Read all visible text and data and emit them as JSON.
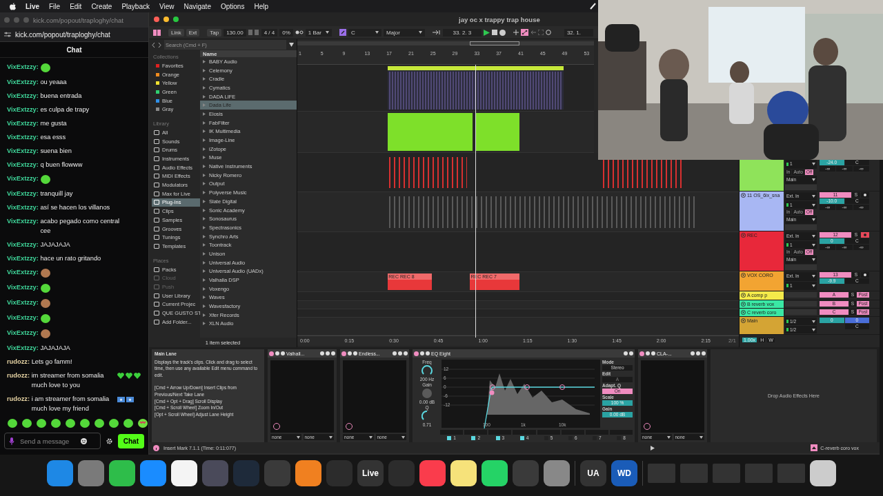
{
  "menu_bar": {
    "app": "Live",
    "items": [
      "File",
      "Edit",
      "Create",
      "Playback",
      "View",
      "Navigate",
      "Options",
      "Help"
    ]
  },
  "chat_window": {
    "title": "kick.com/popout/traploghy/chat",
    "url": "kick.com/popout/traploghy/chat",
    "header": "Chat",
    "messages": [
      {
        "user": "VixExtzzy:",
        "color": "#3fd69a",
        "emotes": [
          {
            "kind": "blob"
          }
        ]
      },
      {
        "user": "VixExtzzy:",
        "color": "#3fd69a",
        "text": "ou yeaaa"
      },
      {
        "user": "VixExtzzy:",
        "color": "#3fd69a",
        "text": "buena entrada"
      },
      {
        "user": "VixExtzzy:",
        "color": "#3fd69a",
        "text": "es culpa de trapy"
      },
      {
        "user": "VixExtzzy:",
        "color": "#3fd69a",
        "text": "me gusta"
      },
      {
        "user": "VixExtzzy:",
        "color": "#3fd69a",
        "text": "esa esss"
      },
      {
        "user": "VixExtzzy:",
        "color": "#3fd69a",
        "text": "suena bien"
      },
      {
        "user": "VixExtzzy:",
        "color": "#3fd69a",
        "text": "q buen flowww"
      },
      {
        "user": "VixExtzzy:",
        "color": "#3fd69a",
        "emotes": [
          {
            "kind": "blob"
          }
        ]
      },
      {
        "user": "VixExtzzy:",
        "color": "#3fd69a",
        "text": "tranquill jay"
      },
      {
        "user": "VixExtzzy:",
        "color": "#3fd69a",
        "text": "así se hacen los villanos"
      },
      {
        "user": "VixExtzzy:",
        "color": "#3fd69a",
        "text": "acabo pegado como central cee"
      },
      {
        "user": "VixExtzzy:",
        "color": "#3fd69a",
        "text": "JAJAJAJA"
      },
      {
        "user": "VixExtzzy:",
        "color": "#3fd69a",
        "text": "hace un rato gritando"
      },
      {
        "user": "VixExtzzy:",
        "color": "#3fd69a",
        "emotes": [
          {
            "kind": "cat"
          }
        ]
      },
      {
        "user": "VixExtzzy:",
        "color": "#3fd69a",
        "emotes": [
          {
            "kind": "blob"
          }
        ]
      },
      {
        "user": "VixExtzzy:",
        "color": "#3fd69a",
        "emotes": [
          {
            "kind": "cat"
          }
        ]
      },
      {
        "user": "VixExtzzy:",
        "color": "#3fd69a",
        "emotes": [
          {
            "kind": "blob"
          }
        ]
      },
      {
        "user": "VixExtzzy:",
        "color": "#3fd69a",
        "emotes": [
          {
            "kind": "cat"
          }
        ]
      },
      {
        "user": "VixExtzzy:",
        "color": "#3fd69a",
        "text": "JAJAJAJA"
      },
      {
        "user": "rudozz:",
        "color": "#e6d3a3",
        "text": "Lets go famm!"
      },
      {
        "user": "rudozz:",
        "color": "#e6d3a3",
        "text": "im streamer from somalia much love to you",
        "emotes": [
          {
            "kind": "heart"
          },
          {
            "kind": "heart"
          },
          {
            "kind": "heart"
          }
        ]
      },
      {
        "user": "rudozz:",
        "color": "#e6d3a3",
        "text": "i am streamer from somalia much love my friend",
        "emotes": [
          {
            "kind": "flag"
          },
          {
            "kind": "flag"
          }
        ]
      }
    ],
    "emote_bar": [
      {
        "kind": "blob"
      },
      {
        "kind": "blob"
      },
      {
        "kind": "blob"
      },
      {
        "kind": "blob"
      },
      {
        "kind": "blob"
      },
      {
        "kind": "blob"
      },
      {
        "kind": "blob"
      },
      {
        "kind": "blob"
      },
      {
        "kind": "blob"
      },
      {
        "kind": "love"
      }
    ],
    "input": {
      "placeholder": "Send a message"
    },
    "send_button": "Chat"
  },
  "daw": {
    "title": "jay oc x trappy trap house",
    "toolbar": {
      "link": "Link",
      "ext": "Ext",
      "tap": "Tap",
      "tempo": "130.00",
      "signature": "4 / 4",
      "groove": "0%",
      "quantize": "1 Bar",
      "key": "C",
      "scale": "Major",
      "position": "33. 2. 3",
      "loop_start": "32. 1."
    },
    "browser": {
      "search_placeholder": "Search (Cmd + F)",
      "collections_title": "Collections",
      "collections": [
        {
          "label": "Favorites",
          "color": "#e02020"
        },
        {
          "label": "Orange",
          "color": "#f08c1e"
        },
        {
          "label": "Yellow",
          "color": "#f0e030"
        },
        {
          "label": "Green",
          "color": "#30d070"
        },
        {
          "label": "Blue",
          "color": "#3090e8"
        },
        {
          "label": "Gray",
          "color": "#8a8a8a"
        }
      ],
      "library_title": "Library",
      "library": [
        {
          "label": "All",
          "selected": false
        },
        {
          "label": "Sounds",
          "selected": false
        },
        {
          "label": "Drums",
          "selected": false
        },
        {
          "label": "Instruments",
          "selected": false
        },
        {
          "label": "Audio Effects",
          "selected": false
        },
        {
          "label": "MIDI Effects",
          "selected": false
        },
        {
          "label": "Modulators",
          "selected": false
        },
        {
          "label": "Max for Live",
          "selected": false
        },
        {
          "label": "Plug-Ins",
          "selected": true
        },
        {
          "label": "Clips",
          "selected": false
        },
        {
          "label": "Samples",
          "selected": false
        },
        {
          "label": "Grooves",
          "selected": false
        },
        {
          "label": "Tunings",
          "selected": false
        },
        {
          "label": "Templates",
          "selected": false
        }
      ],
      "places_title": "Places",
      "places": [
        {
          "label": "Packs",
          "disabled": false
        },
        {
          "label": "Cloud",
          "disabled": true
        },
        {
          "label": "Push",
          "disabled": true
        },
        {
          "label": "User Library",
          "disabled": false
        },
        {
          "label": "Current Projec",
          "disabled": false
        },
        {
          "label": "QUE GUSTO ST",
          "disabled": false
        },
        {
          "label": "Add Folder...",
          "disabled": false
        }
      ],
      "column": "Name",
      "items": [
        {
          "label": "BABY Audio",
          "selected": false
        },
        {
          "label": "Celemony",
          "selected": false
        },
        {
          "label": "Cradle",
          "selected": false
        },
        {
          "label": "Cymatics",
          "selected": false
        },
        {
          "label": "DADA LIFE",
          "selected": false
        },
        {
          "label": "Dada Life",
          "selected": true
        },
        {
          "label": "Eiosis",
          "selected": false
        },
        {
          "label": "FabFilter",
          "selected": false
        },
        {
          "label": "IK Multimedia",
          "selected": false
        },
        {
          "label": "Image-Line",
          "selected": false
        },
        {
          "label": "iZotope",
          "selected": false
        },
        {
          "label": "Muse",
          "selected": false
        },
        {
          "label": "Native Instruments",
          "selected": false
        },
        {
          "label": "Nicky Romero",
          "selected": false
        },
        {
          "label": "Output",
          "selected": false
        },
        {
          "label": "Polyverse Music",
          "selected": false
        },
        {
          "label": "Slate Digital",
          "selected": false
        },
        {
          "label": "Sonic Academy",
          "selected": false
        },
        {
          "label": "Sonosaurus",
          "selected": false
        },
        {
          "label": "Spectrasonics",
          "selected": false
        },
        {
          "label": "Synchro Arts",
          "selected": false
        },
        {
          "label": "Toontrack",
          "selected": false
        },
        {
          "label": "Unison",
          "selected": false
        },
        {
          "label": "Universal Audio",
          "selected": false
        },
        {
          "label": "Universal Audio (UADx)",
          "selected": false
        },
        {
          "label": "Valhalla DSP",
          "selected": false
        },
        {
          "label": "Voxengo",
          "selected": false
        },
        {
          "label": "Waves",
          "selected": false
        },
        {
          "label": "Wavesfactory",
          "selected": false
        },
        {
          "label": "Xfer Records",
          "selected": false
        },
        {
          "label": "XLN Audio",
          "selected": false
        }
      ],
      "status": "1 item selected"
    },
    "ruler": [
      "1",
      "5",
      "9",
      "13",
      "17",
      "21",
      "25",
      "29",
      "33",
      "37",
      "41",
      "45",
      "49",
      "53"
    ],
    "time_ruler": [
      "0:00",
      "0:15",
      "0:30",
      "0:45",
      "1:00",
      "1:15",
      "1:30",
      "1:45",
      "2:00",
      "2:15"
    ],
    "zoom_label": "2/1",
    "lanes": [
      {
        "clips": [
          {
            "kind": "midi",
            "color": "#c6e83a"
          }
        ]
      },
      {
        "clips": [
          {
            "kind": "audio",
            "color": "#7ee02a"
          },
          {
            "kind": "audio",
            "color": "#7ee02a"
          }
        ]
      },
      {
        "clips": [
          {
            "kind": "marks",
            "color": "#d83030"
          },
          {
            "kind": "marks",
            "color": "#d83030"
          }
        ],
        "track": {
          "kind": "audio",
          "color": "#8fe35a",
          "channel": "1",
          "volume": "-24.0",
          "pan": "C",
          "monitor": [
            {
              "label": "In",
              "selected": false
            },
            {
              "label": "Auto",
              "selected": false
            },
            {
              "label": "Off",
              "selected": true
            }
          ],
          "sends": [
            "-∞",
            "-∞",
            "-∞"
          ],
          "output": "Main"
        }
      },
      {
        "clips": [
          {
            "kind": "marks",
            "color": "#5a5a5a"
          }
        ],
        "track": {
          "kind": "audio",
          "name": "11 OS_6ix_sna",
          "color": "#a8b7f3",
          "input": "Ext. In",
          "channel": "1",
          "number": "11",
          "solo": "S",
          "armed": false,
          "volume": "-10.0",
          "pan": "C",
          "monitor": [
            {
              "label": "In",
              "selected": false
            },
            {
              "label": "Auto",
              "selected": false
            },
            {
              "label": "Off",
              "selected": true
            }
          ],
          "sends": [
            "-∞",
            "-∞",
            "-∞"
          ],
          "output": "Main"
        }
      },
      {
        "track": {
          "kind": "audio",
          "name": "REC",
          "color": "#e8283a",
          "input": "Ext. In",
          "channel": "1",
          "number": "12",
          "solo": "S",
          "armed": true,
          "volume": "0",
          "pan": "C",
          "monitor": [
            {
              "label": "In",
              "selected": false
            },
            {
              "label": "Auto",
              "selected": false
            },
            {
              "label": "Off",
              "selected": true
            }
          ],
          "sends": [
            "-∞",
            "-∞",
            "-∞"
          ],
          "output": "Main"
        }
      },
      {
        "clips": [
          {
            "kind": "audio",
            "color": "#e8383a",
            "label": "REC REC 8"
          },
          {
            "kind": "audio",
            "color": "#e8383a",
            "label": "REC REC 7"
          }
        ],
        "track": {
          "kind": "audio",
          "name": "VOX CORO",
          "color": "#f2a432",
          "input": "Ext. In",
          "channel": "1",
          "number": "13",
          "solo": "S",
          "armed": false,
          "volume": "-9.9",
          "pan": "C"
        }
      },
      {
        "track": {
          "kind": "return",
          "name": "A comp p",
          "color": "#f4ea4a",
          "letter": "A",
          "solo": "S",
          "mode": "Post"
        }
      },
      {
        "track": {
          "kind": "return",
          "name": "B reverb vox",
          "color": "#3ae8a4",
          "letter": "B",
          "solo": "S",
          "mode": "Post"
        }
      },
      {
        "track": {
          "kind": "return",
          "name": "C reverb coro",
          "color": "#3ae8a4",
          "letter": "C",
          "solo": "S",
          "mode": "Post"
        }
      },
      {
        "track": {
          "kind": "main",
          "name": "Main",
          "color": "#d4a434",
          "inputs": [
            "1/2",
            "1/2"
          ],
          "volume": "0",
          "cue": "0",
          "pan": "C"
        }
      }
    ],
    "zoom": {
      "value": "1.00x",
      "h": "H",
      "w": "W"
    },
    "info": {
      "title": "Main Lane",
      "text": "Displays the track's clips. Click and drag to select time, then use any available Edit menu command to edit.",
      "shortcuts": [
        "[Cmd + Arrow Up/Down] Insert Clips from Previous/Next Take Lane",
        "[Cmd + Opt + Drag] Scroll Display",
        "[Cmd + Scroll Wheel] Zoom In/Out",
        "[Opt + Scroll Wheel] Adjust Lane Height"
      ]
    },
    "devices": [
      {
        "kind": "plugin",
        "name": "Valhall...",
        "selectors": [
          "none",
          "none"
        ]
      },
      {
        "kind": "plugin",
        "name": "Endless...",
        "selectors": [
          "none",
          "none"
        ]
      },
      {
        "kind": "eq",
        "name": "EQ Eight",
        "freq_label": "Freq",
        "freq": "200 Hz",
        "gain_label": "Gain",
        "gain": "0.00 dB",
        "q_label": "Q",
        "q": "0.71",
        "y_ticks": [
          "12",
          "6",
          "0",
          "-6",
          "-12"
        ],
        "x_ticks": [
          "100",
          "1k",
          "10k"
        ],
        "bands": [
          {
            "label": "1",
            "on": true
          },
          {
            "label": "2",
            "on": true
          },
          {
            "label": "3",
            "on": true
          },
          {
            "label": "4",
            "on": true
          },
          {
            "label": "5",
            "on": false
          },
          {
            "label": "6",
            "on": false
          },
          {
            "label": "7",
            "on": false
          },
          {
            "label": "8",
            "on": false
          }
        ],
        "mode_label": "Mode",
        "mode": "Stereo",
        "edit_label": "Edit",
        "edit": "A",
        "adapt_label": "Adapt. Q",
        "adapt": "On",
        "scale_label": "Scale",
        "scale": "100 %",
        "out_label": "Gain",
        "out_gain": "0.00 dB"
      },
      {
        "kind": "plugin",
        "name": "CLA-...",
        "selectors": [
          "none",
          "none"
        ]
      }
    ],
    "drop_hint": "Drop Audio Effects Here",
    "status_bar": {
      "message": "Insert Mark 7.1.1 (Time: 0:11:077)",
      "track": "C-reverb coro vox"
    }
  },
  "dock_labels": [
    "Live",
    "UA",
    "WD"
  ]
}
